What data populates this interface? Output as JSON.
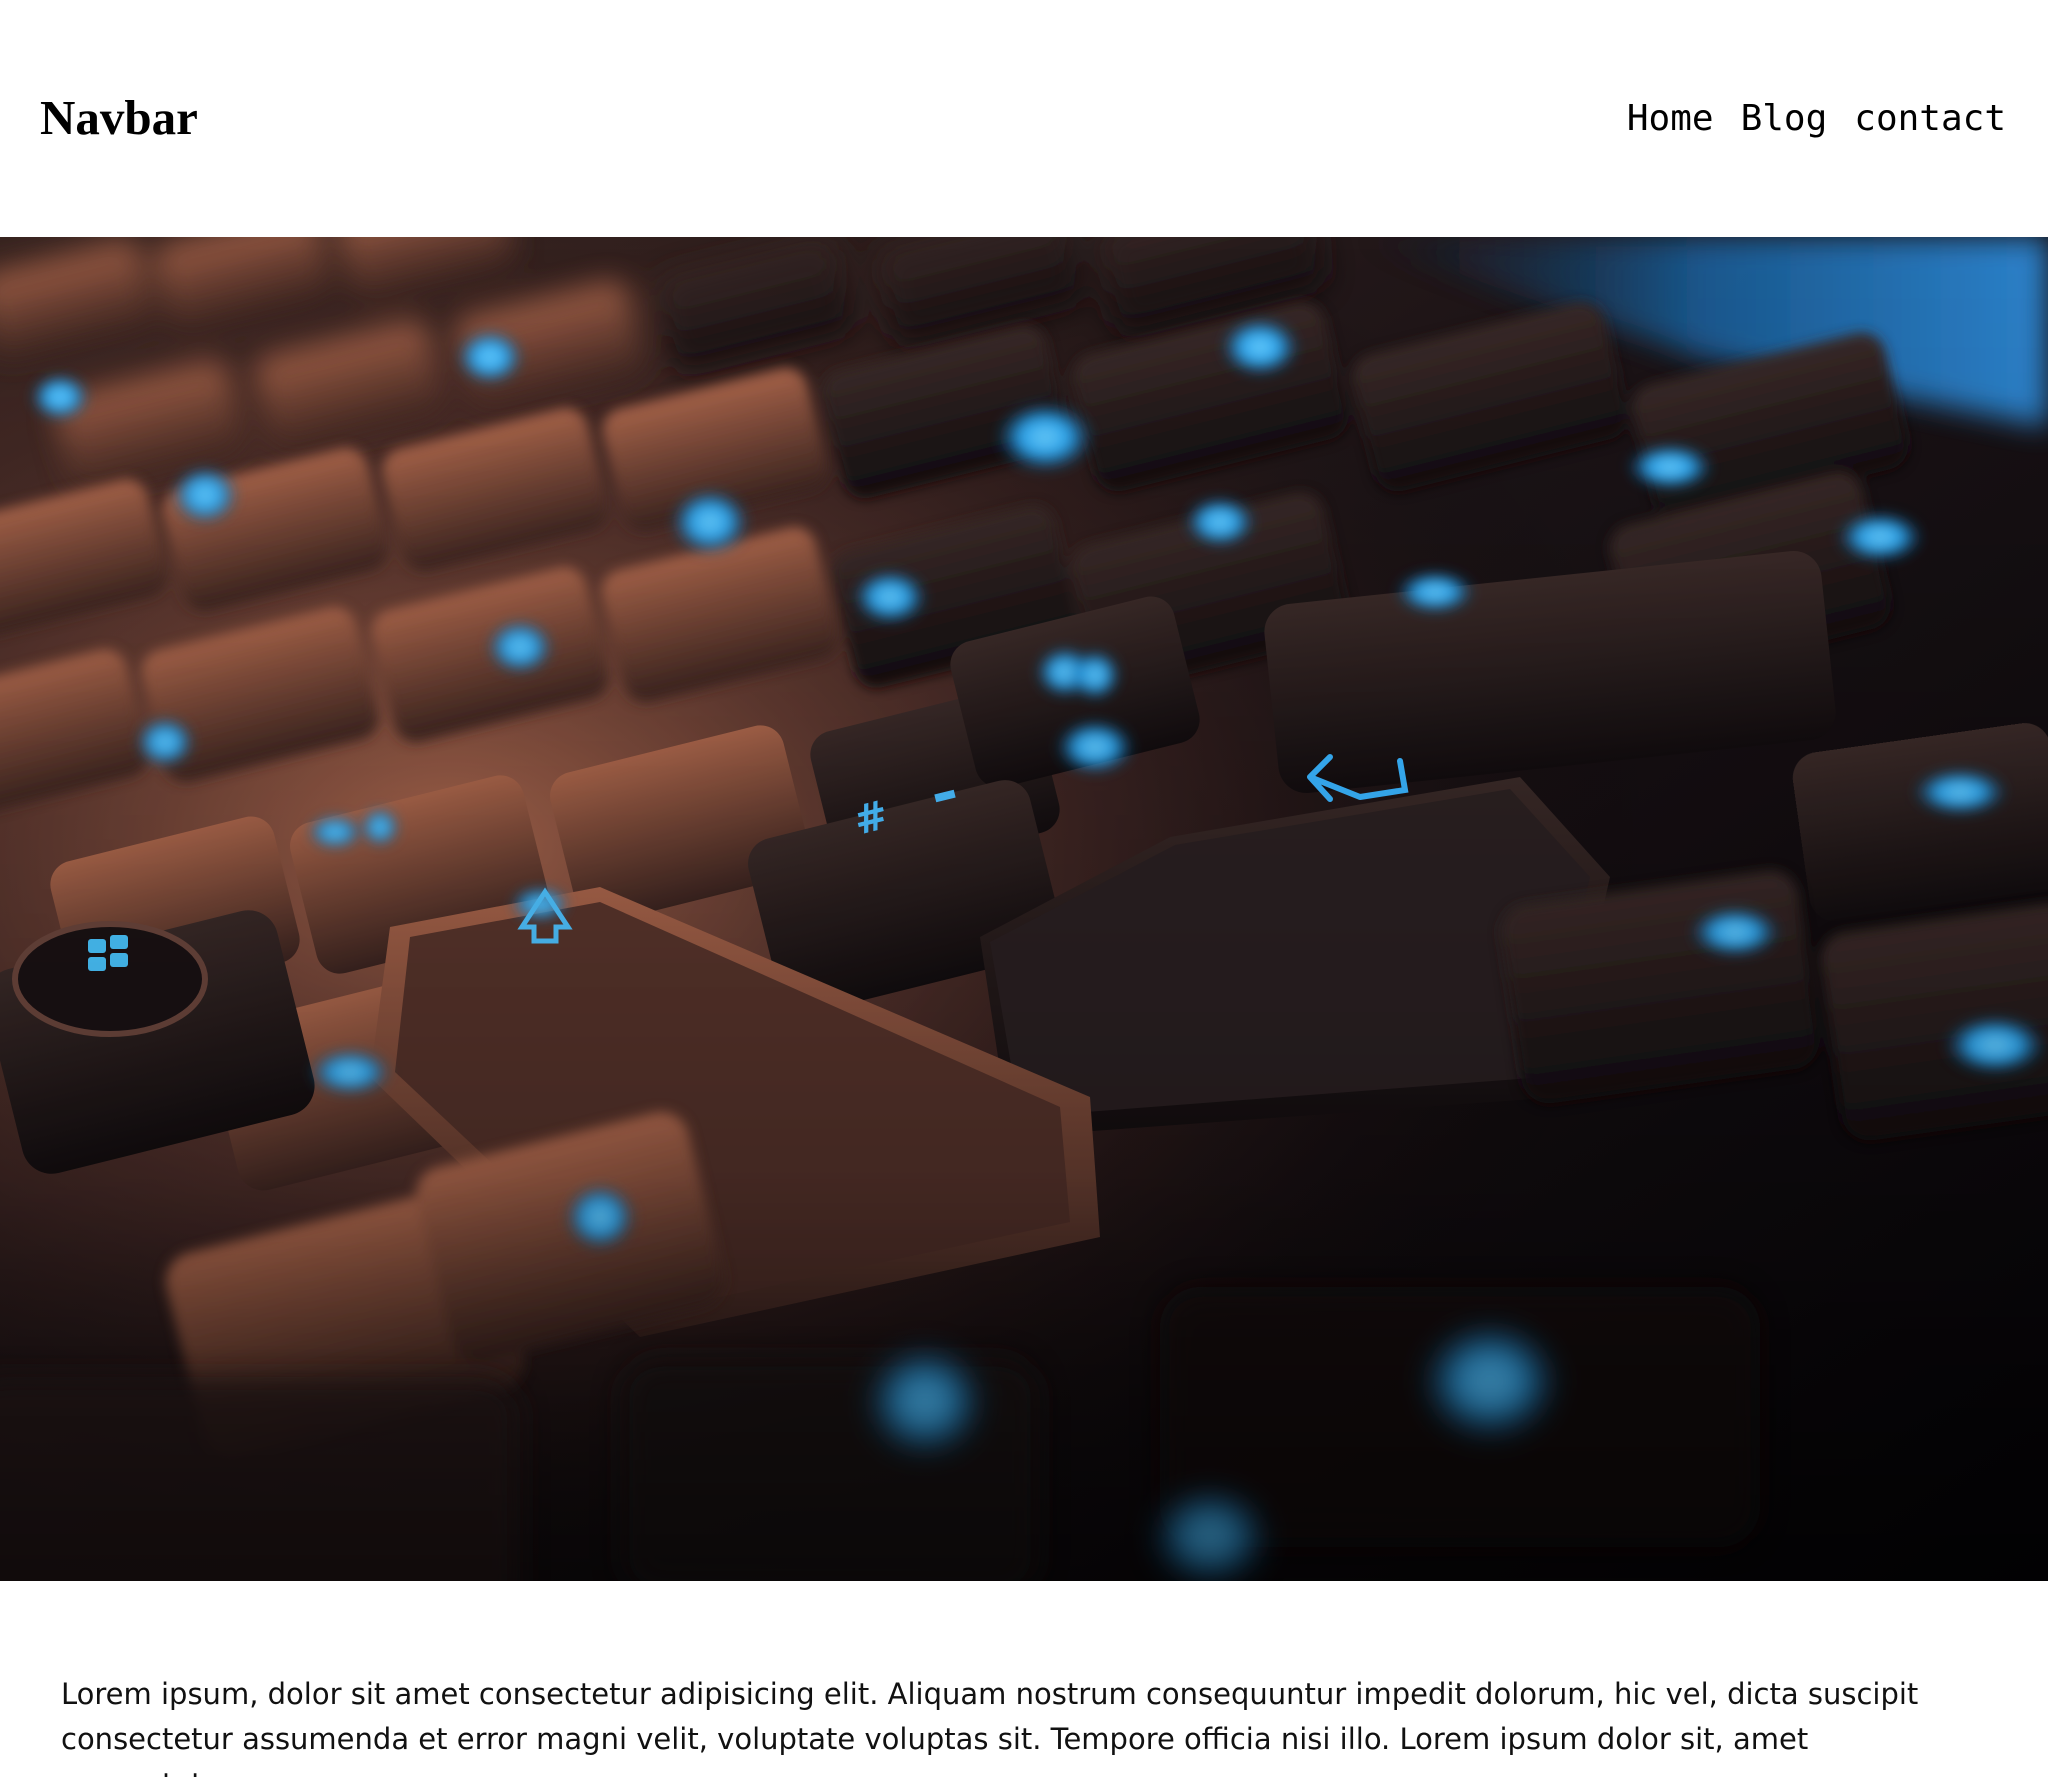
{
  "navbar": {
    "brand": "Navbar",
    "links": [
      {
        "label": "Home"
      },
      {
        "label": "Blog"
      },
      {
        "label": "contact"
      }
    ]
  },
  "hero": {
    "subject": "keyboard-photo",
    "colors": {
      "backlight": "#27a6f0",
      "key_warm": "#b86c4f",
      "background": "#0b0a0d"
    }
  },
  "content": {
    "paragraph": "Lorem ipsum, dolor sit amet consectetur adipisicing elit. Aliquam nostrum consequuntur impedit dolorum, hic vel, dicta suscipit consectetur assumenda et error magni velit, voluptate voluptas sit. Tempore officia nisi illo. Lorem ipsum dolor sit, amet consectetur"
  }
}
